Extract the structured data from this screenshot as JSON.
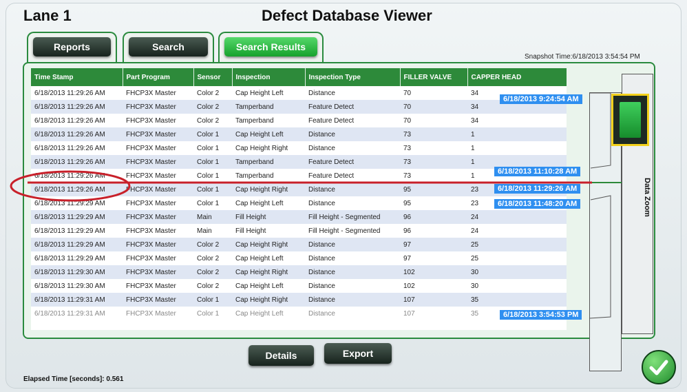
{
  "header": {
    "lane": "Lane 1",
    "title": "Defect Database Viewer"
  },
  "tabs": [
    {
      "label": "Reports",
      "active": false
    },
    {
      "label": "Search",
      "active": false
    },
    {
      "label": "Search Results",
      "active": true
    }
  ],
  "snapshot_time": "Snapshot Time:6/18/2013 3:54:54 PM",
  "table": {
    "columns": [
      "Time Stamp",
      "Part Program",
      "Sensor",
      "Inspection",
      "Inspection Type",
      "FILLER VALVE",
      "CAPPER HEAD"
    ],
    "rows": [
      [
        "6/18/2013 11:29:26 AM",
        "FHCP3X Master",
        "Color 2",
        "Cap Height Left",
        "Distance",
        "70",
        "34"
      ],
      [
        "6/18/2013 11:29:26 AM",
        "FHCP3X Master",
        "Color 2",
        "Tamperband",
        "Feature Detect",
        "70",
        "34"
      ],
      [
        "6/18/2013 11:29:26 AM",
        "FHCP3X Master",
        "Color 2",
        "Tamperband",
        "Feature Detect",
        "70",
        "34"
      ],
      [
        "6/18/2013 11:29:26 AM",
        "FHCP3X Master",
        "Color 1",
        "Cap Height Left",
        "Distance",
        "73",
        "1"
      ],
      [
        "6/18/2013 11:29:26 AM",
        "FHCP3X Master",
        "Color 1",
        "Cap Height Right",
        "Distance",
        "73",
        "1"
      ],
      [
        "6/18/2013 11:29:26 AM",
        "FHCP3X Master",
        "Color 1",
        "Tamperband",
        "Feature Detect",
        "73",
        "1"
      ],
      [
        "6/18/2013 11:29:26 AM",
        "FHCP3X Master",
        "Color 1",
        "Tamperband",
        "Feature Detect",
        "73",
        "1"
      ],
      [
        "6/18/2013 11:29:26 AM",
        "FHCP3X Master",
        "Color 1",
        "Cap Height Right",
        "Distance",
        "95",
        "23"
      ],
      [
        "6/18/2013 11:29:29 AM",
        "FHCP3X Master",
        "Color 1",
        "Cap Height Left",
        "Distance",
        "95",
        "23"
      ],
      [
        "6/18/2013 11:29:29 AM",
        "FHCP3X Master",
        "Main",
        "Fill Height",
        "Fill Height - Segmented",
        "96",
        "24"
      ],
      [
        "6/18/2013 11:29:29 AM",
        "FHCP3X Master",
        "Main",
        "Fill Height",
        "Fill Height - Segmented",
        "96",
        "24"
      ],
      [
        "6/18/2013 11:29:29 AM",
        "FHCP3X Master",
        "Color 2",
        "Cap Height Right",
        "Distance",
        "97",
        "25"
      ],
      [
        "6/18/2013 11:29:29 AM",
        "FHCP3X Master",
        "Color 2",
        "Cap Height Left",
        "Distance",
        "97",
        "25"
      ],
      [
        "6/18/2013 11:29:30 AM",
        "FHCP3X Master",
        "Color 2",
        "Cap Height Right",
        "Distance",
        "102",
        "30"
      ],
      [
        "6/18/2013 11:29:30 AM",
        "FHCP3X Master",
        "Color 2",
        "Cap Height Left",
        "Distance",
        "102",
        "30"
      ],
      [
        "6/18/2013 11:29:31 AM",
        "FHCP3X Master",
        "Color 1",
        "Cap Height Right",
        "Distance",
        "107",
        "35"
      ],
      [
        "6/18/2013 11:29:31 AM",
        "FHCP3X Master",
        "Color 1",
        "Cap Height Left",
        "Distance",
        "107",
        "35"
      ]
    ]
  },
  "timeline_labels": [
    "6/18/2013 9:24:54 AM",
    "6/18/2013 11:10:28 AM",
    "6/18/2013 11:29:26 AM",
    "6/18/2013 11:48:20 AM",
    "6/18/2013 3:54:53 PM"
  ],
  "zoom_label": "Data Zoom",
  "actions": {
    "details": "Details",
    "export": "Export"
  },
  "elapsed": "Elapsed Time [seconds]: 0.561",
  "colors": {
    "accent": "#2d8a3a",
    "highlight_ring": "#c8202a",
    "timeline_label": "#2f8ff0",
    "zoom_handle_border": "#f3d11c"
  }
}
